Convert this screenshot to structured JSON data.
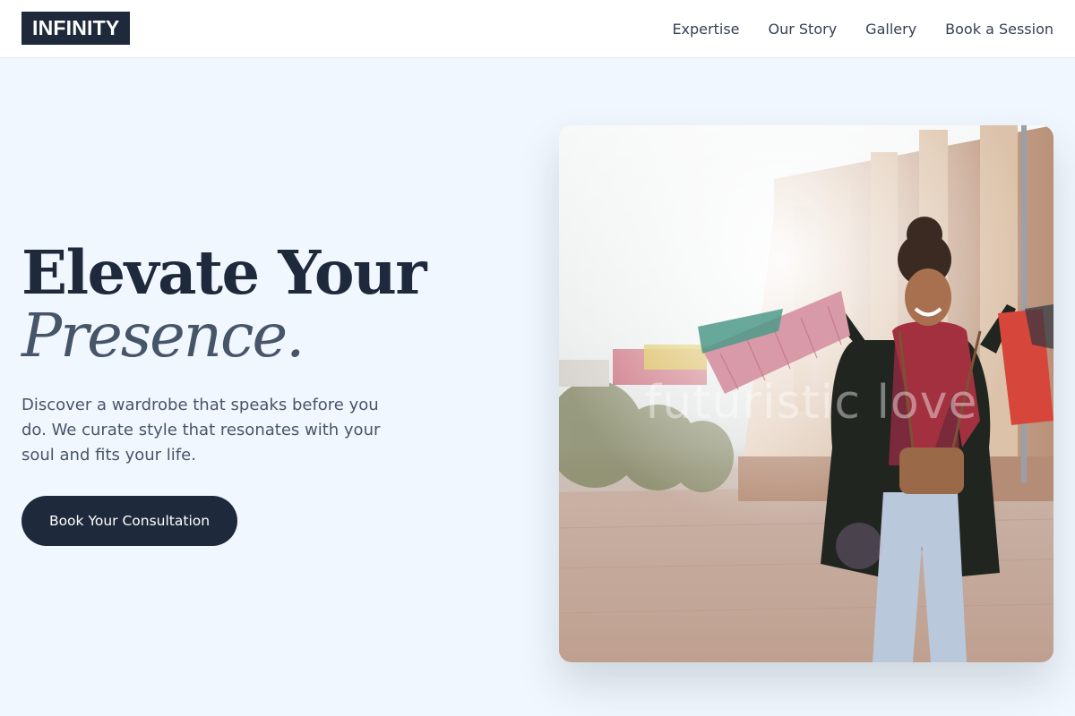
{
  "header": {
    "logo": "INFINITY",
    "nav": [
      "Expertise",
      "Our Story",
      "Gallery",
      "Book a Session"
    ]
  },
  "hero": {
    "title_line1": "Elevate Your",
    "title_line2": "Presence.",
    "subtitle": "Discover a wardrobe that speaks before you do. We curate style that resonates with your soul and fits your life.",
    "cta_label": "Book Your Consultation"
  },
  "photo": {
    "watermark": "futuristic love"
  },
  "colors": {
    "page_bg": "#f1f7fe",
    "navy": "#1e293b",
    "slate": "#475569"
  }
}
